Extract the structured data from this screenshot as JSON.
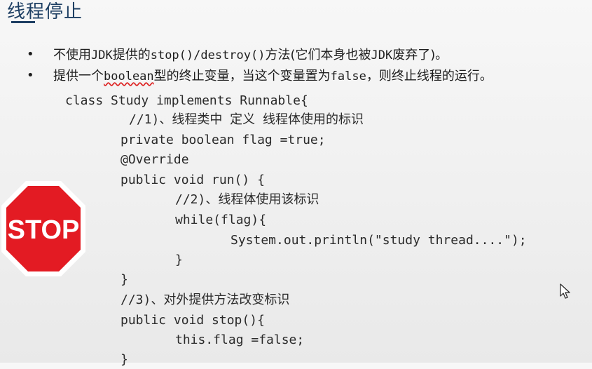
{
  "title": "线程停止",
  "bullets": [
    {
      "marker": "•",
      "pre": "不使用",
      "code1": "JDK",
      "mid1": "提供的",
      "code2": "stop()/destroy()",
      "mid2": "方法(它们本身也被",
      "code3": "JDK",
      "post": "废弃了)。"
    },
    {
      "marker": "•",
      "pre": "提供一个",
      "code1": "boolean",
      "mid1": "型的终止变量，当这个变量置为",
      "code2": "false",
      "post": "，则终止线程的运行。"
    }
  ],
  "code_lines": [
    "class Study implements Runnable{",
    "//1)、线程类中 定义 线程体使用的标识",
    "private boolean flag =true;",
    "@Override",
    "public void run() {",
    "//2)、线程体使用该标识",
    "while(flag){",
    "System.out.println(\"study thread....\");",
    "}",
    "}",
    "//3)、对外提供方法改变标识",
    "public void stop(){",
    "this.flag =false;",
    "}"
  ],
  "stop_sign": {
    "text": "STOP",
    "fill_color": "#e31b23",
    "border_color": "#ffffff"
  },
  "colors": {
    "title": "#1e3f63",
    "text": "#1e1e1e",
    "code": "#2a2a2a"
  },
  "icons": {
    "cursor": "mouse-pointer-icon",
    "stop": "stop-sign-icon"
  }
}
